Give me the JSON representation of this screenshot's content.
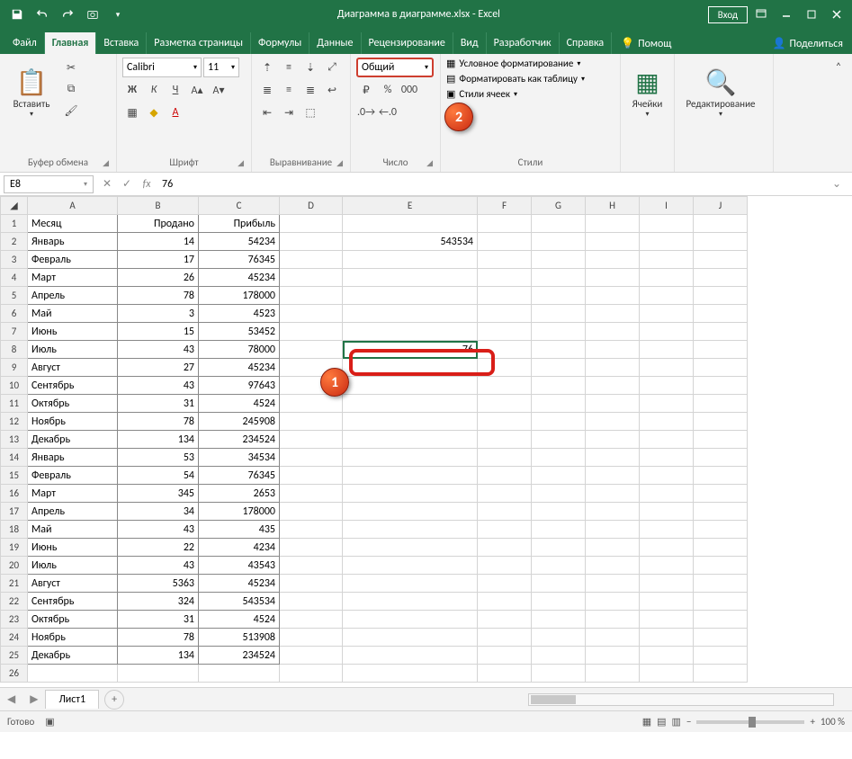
{
  "title": "Диаграмма в диаграмме.xlsx - Excel",
  "login": "Вход",
  "tabs": {
    "file": "Файл",
    "home": "Главная",
    "insert": "Вставка",
    "pagelayout": "Разметка страницы",
    "formulas": "Формулы",
    "data": "Данные",
    "review": "Рецензирование",
    "view": "Вид",
    "developer": "Разработчик",
    "help": "Справка",
    "tellme": "Помощ",
    "share": "Поделиться"
  },
  "ribbon": {
    "clipboard": {
      "paste": "Вставить",
      "label": "Буфер обмена"
    },
    "font": {
      "name": "Calibri",
      "size": "11",
      "label": "Шрифт"
    },
    "alignment": {
      "label": "Выравнивание"
    },
    "number": {
      "format": "Общий",
      "label": "Число"
    },
    "styles": {
      "conditional": "Условное форматирование",
      "table": "Форматировать как таблицу",
      "cellstyles": "Стили ячеек",
      "label": "Стили"
    },
    "cells": {
      "label": "Ячейки"
    },
    "editing": {
      "label": "Редактирование"
    }
  },
  "namebox": "E8",
  "formula": "76",
  "columns": [
    "A",
    "B",
    "C",
    "D",
    "E",
    "F",
    "G",
    "H",
    "I",
    "J"
  ],
  "headers": [
    "Месяц",
    "Продано",
    "Прибыль"
  ],
  "rows": [
    {
      "r": 1,
      "a": "Месяц",
      "b": "Продано",
      "c": "Прибыль",
      "e": ""
    },
    {
      "r": 2,
      "a": "Январь",
      "b": "14",
      "c": "54234",
      "e": "543534"
    },
    {
      "r": 3,
      "a": "Февраль",
      "b": "17",
      "c": "76345",
      "e": ""
    },
    {
      "r": 4,
      "a": "Март",
      "b": "26",
      "c": "45234",
      "e": ""
    },
    {
      "r": 5,
      "a": "Апрель",
      "b": "78",
      "c": "178000",
      "e": ""
    },
    {
      "r": 6,
      "a": "Май",
      "b": "3",
      "c": "4523",
      "e": ""
    },
    {
      "r": 7,
      "a": "Июнь",
      "b": "15",
      "c": "53452",
      "e": ""
    },
    {
      "r": 8,
      "a": "Июль",
      "b": "43",
      "c": "78000",
      "e": "76"
    },
    {
      "r": 9,
      "a": "Август",
      "b": "27",
      "c": "45234",
      "e": ""
    },
    {
      "r": 10,
      "a": "Сентябрь",
      "b": "43",
      "c": "97643",
      "e": ""
    },
    {
      "r": 11,
      "a": "Октябрь",
      "b": "31",
      "c": "4524",
      "e": ""
    },
    {
      "r": 12,
      "a": "Ноябрь",
      "b": "78",
      "c": "245908",
      "e": ""
    },
    {
      "r": 13,
      "a": "Декабрь",
      "b": "134",
      "c": "234524",
      "e": ""
    },
    {
      "r": 14,
      "a": "Январь",
      "b": "53",
      "c": "34534",
      "e": ""
    },
    {
      "r": 15,
      "a": "Февраль",
      "b": "54",
      "c": "76345",
      "e": ""
    },
    {
      "r": 16,
      "a": "Март",
      "b": "345",
      "c": "2653",
      "e": ""
    },
    {
      "r": 17,
      "a": "Апрель",
      "b": "34",
      "c": "178000",
      "e": ""
    },
    {
      "r": 18,
      "a": "Май",
      "b": "43",
      "c": "435",
      "e": ""
    },
    {
      "r": 19,
      "a": "Июнь",
      "b": "22",
      "c": "4234",
      "e": ""
    },
    {
      "r": 20,
      "a": "Июль",
      "b": "43",
      "c": "43543",
      "e": ""
    },
    {
      "r": 21,
      "a": "Август",
      "b": "5363",
      "c": "45234",
      "e": ""
    },
    {
      "r": 22,
      "a": "Сентябрь",
      "b": "324",
      "c": "543534",
      "e": ""
    },
    {
      "r": 23,
      "a": "Октябрь",
      "b": "31",
      "c": "4524",
      "e": ""
    },
    {
      "r": 24,
      "a": "Ноябрь",
      "b": "78",
      "c": "513908",
      "e": ""
    },
    {
      "r": 25,
      "a": "Декабрь",
      "b": "134",
      "c": "234524",
      "e": ""
    }
  ],
  "sheet": "Лист1",
  "status": "Готово",
  "zoom": "100 %",
  "callouts": {
    "c1": "1",
    "c2": "2"
  },
  "colors": {
    "accent": "#217346",
    "highlight": "#d91e18"
  }
}
